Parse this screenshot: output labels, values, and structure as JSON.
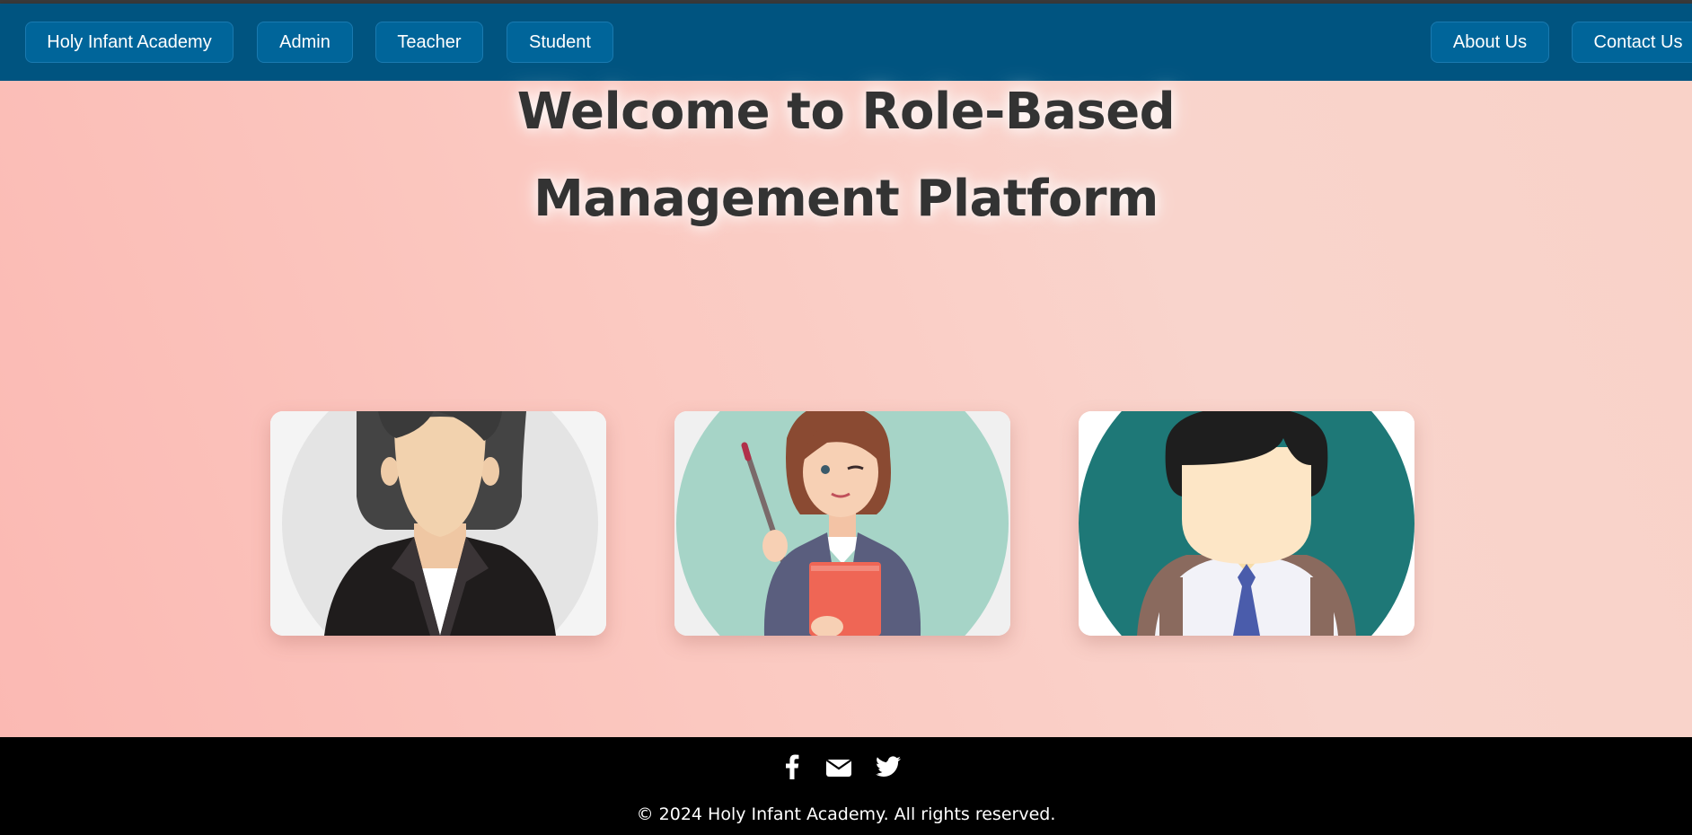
{
  "nav": {
    "brand": "Holy Infant Academy",
    "left_items": [
      "Admin",
      "Teacher",
      "Student"
    ],
    "right_items": [
      "About Us",
      "Contact Us"
    ]
  },
  "hero": {
    "title_line1": "Welcome to Role-Based",
    "title_line2": "Management Platform"
  },
  "cards": [
    {
      "role_icon": "admin-avatar-icon"
    },
    {
      "role_icon": "teacher-avatar-icon"
    },
    {
      "role_icon": "student-avatar-icon"
    }
  ],
  "footer": {
    "social_icons": [
      "facebook-icon",
      "email-icon",
      "twitter-icon"
    ],
    "copyright": "© 2024 Holy Infant Academy. All rights reserved."
  },
  "colors": {
    "navbar": "#005480",
    "nav_button": "#00659a",
    "footer": "#000000",
    "title_text": "#333333"
  }
}
